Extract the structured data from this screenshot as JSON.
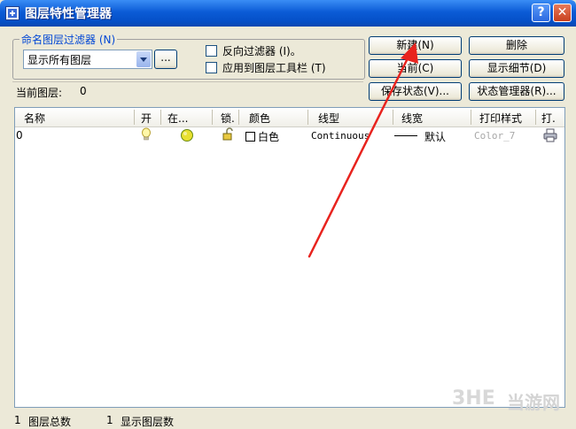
{
  "window": {
    "title": "图层特性管理器",
    "help_glyph": "?",
    "close_glyph": "✕"
  },
  "filter_group": {
    "legend": "命名图层过滤器 (N)",
    "selected": "显示所有图层",
    "browse_label": "..."
  },
  "options": {
    "invert": "反向过滤器 (I)。",
    "apply_toolbar": "应用到图层工具栏 (T)"
  },
  "buttons": {
    "new": "新建(N)",
    "delete": "删除",
    "current": "当前(C)",
    "show_details": "显示细节(D)",
    "save_state": "保存状态(V)...",
    "state_manager": "状态管理器(R)..."
  },
  "current_layer": {
    "label": "当前图层:",
    "value": "0"
  },
  "table": {
    "columns": [
      "名称",
      "开",
      "在...",
      "锁.",
      "颜色",
      "线型",
      "线宽",
      "打印样式",
      "打."
    ],
    "rows": [
      {
        "name": "0",
        "color": "白色",
        "linetype": "Continuous",
        "lineweight": "默认",
        "plot_style": "Color_7"
      }
    ]
  },
  "status": {
    "total_count": "1",
    "total_label": "图层总数",
    "shown_count": "1",
    "shown_label": "显示图层数"
  },
  "watermark": {
    "text": "当游网"
  },
  "colors": {
    "title_bar": "#0b5bd6",
    "annotation_arrow": "#e8231e",
    "legend_text": "#0046d5"
  }
}
